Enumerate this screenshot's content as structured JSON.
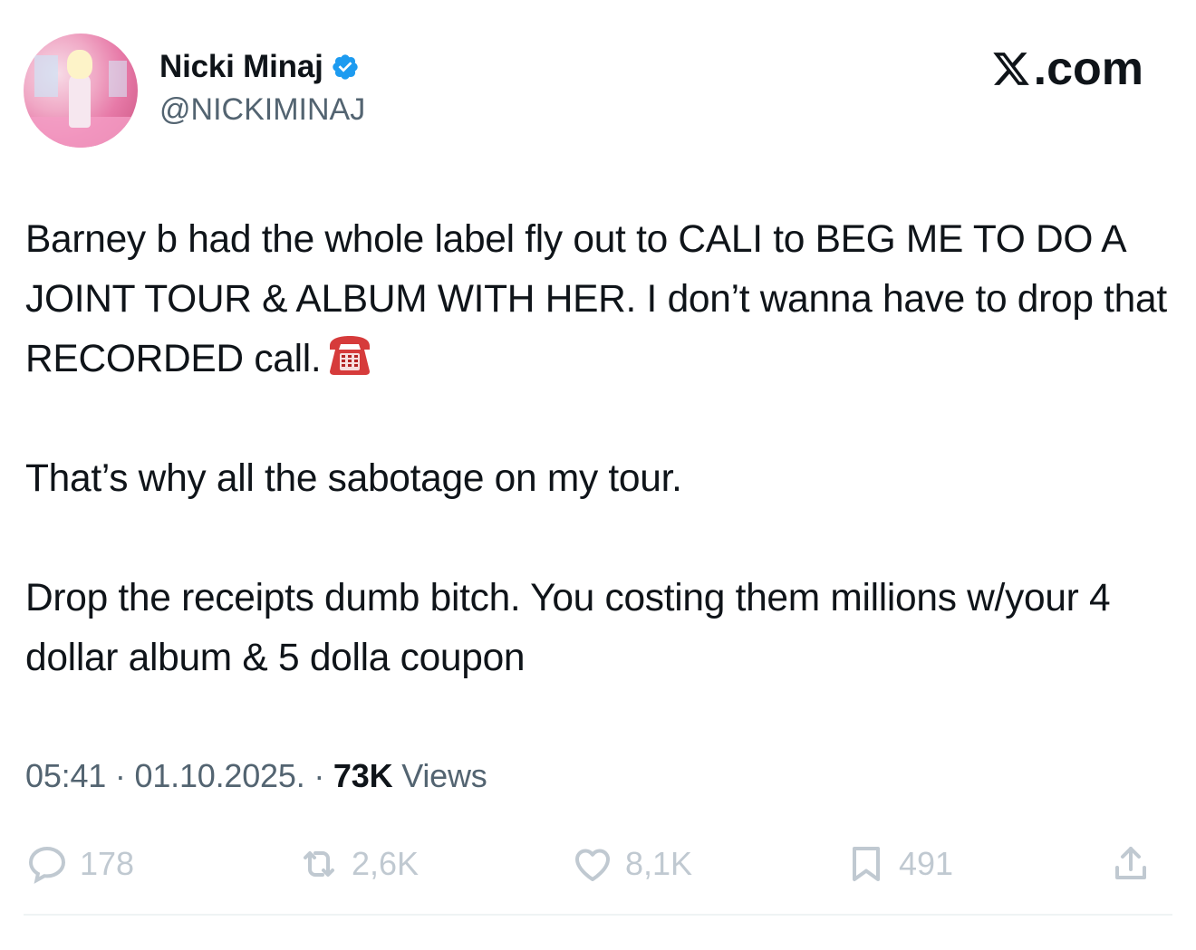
{
  "author": {
    "name": "Nicki Minaj",
    "handle": "@NICKIMINAJ",
    "verified": true,
    "avatar": "profile-photo-avatar"
  },
  "brand": {
    "label": ".com",
    "logo_icon": "x-logo-icon"
  },
  "tweet": {
    "paragraphs": [
      "Barney b had the whole label fly out to CALI to BEG ME TO DO A JOINT TOUR & ALBUM WITH HER. I don’t wanna have to drop that RECORDED call.",
      "That’s why all the sabotage on my tour.",
      "Drop the receipts dumb bitch. You costing them millions w/your 4 dollar album & 5 dolla coupon"
    ],
    "emoji_icon": "telephone-icon"
  },
  "meta": {
    "time": "05:41",
    "date": "01.10.2025.",
    "separator": "·",
    "views_count": "73K",
    "views_label": "Views"
  },
  "actions": {
    "replies": "178",
    "reposts": "2,6K",
    "likes": "8,1K",
    "bookmarks": "491"
  },
  "colors": {
    "text": "#0f1419",
    "secondary": "#536471",
    "verified": "#1d9bf0",
    "action_muted": "#c0c9d1"
  }
}
